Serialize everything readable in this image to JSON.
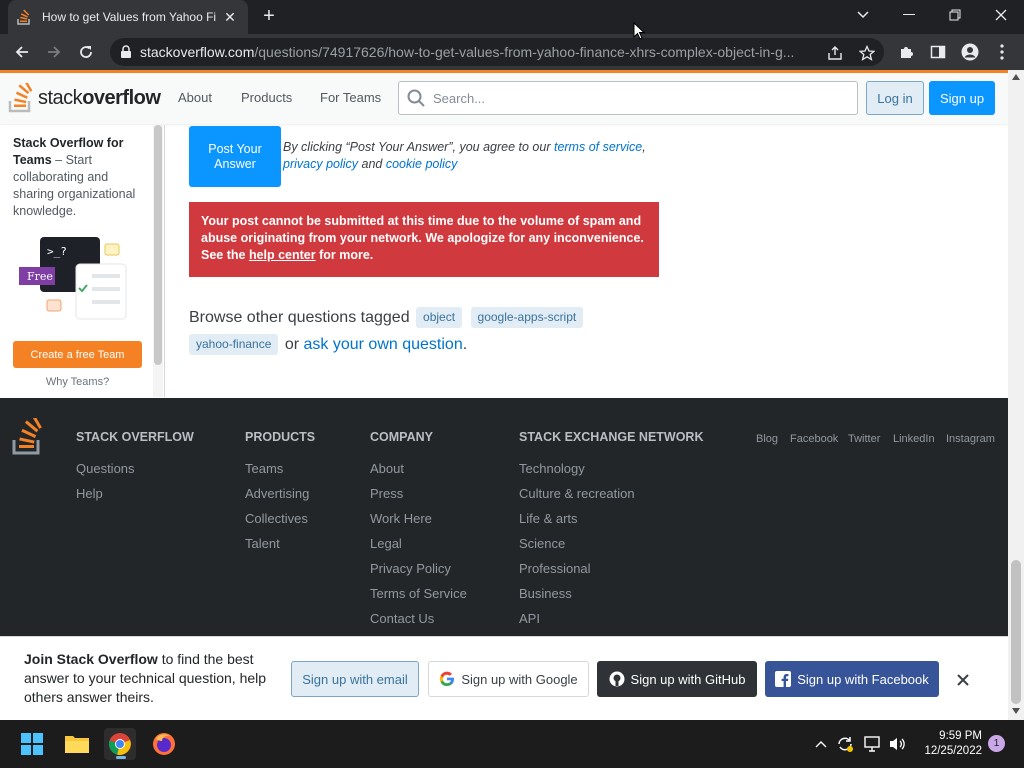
{
  "browser": {
    "tab_title": "How to get Values from Yahoo Fi",
    "url_host": "stackoverflow.com",
    "url_path": "/questions/74917626/how-to-get-values-from-yahoo-finance-xhrs-complex-object-in-g..."
  },
  "header": {
    "logo_prefix": "stack",
    "logo_suffix": "overflow",
    "nav": [
      "About",
      "Products",
      "For Teams"
    ],
    "search_placeholder": "Search...",
    "login_label": "Log in",
    "signup_label": "Sign up"
  },
  "sidebar": {
    "teams_title": "Stack Overflow for Teams",
    "teams_desc": " – Start collaborating and sharing organizational knowledge.",
    "free_badge": "Free",
    "prompt_glyph": ">_?",
    "create_team_label": "Create a free Team",
    "why_teams_label": "Why Teams?"
  },
  "answer": {
    "post_button_label": "Post Your Answer",
    "agree_prefix": "By clicking “Post Your Answer”, you agree to our ",
    "terms_link": "terms of service",
    "comma": ",",
    "privacy_link": "privacy policy",
    "and_text": " and ",
    "cookie_link": "cookie policy",
    "error_text_1": "Your post cannot be submitted at this time due to the volume of spam and abuse originating from your network. We apologize for any inconvenience. See the ",
    "error_link": "help center",
    "error_text_2": " for more.",
    "browse_prefix": "Browse other questions tagged ",
    "tags": [
      "object",
      "google-apps-script",
      "yahoo-finance"
    ],
    "or_text": " or ",
    "ask_link": "ask your own question",
    "period": "."
  },
  "footer": {
    "columns": [
      {
        "heading": "STACK OVERFLOW",
        "links": [
          "Questions",
          "Help"
        ]
      },
      {
        "heading": "PRODUCTS",
        "links": [
          "Teams",
          "Advertising",
          "Collectives",
          "Talent"
        ]
      },
      {
        "heading": "COMPANY",
        "links": [
          "About",
          "Press",
          "Work Here",
          "Legal",
          "Privacy Policy",
          "Terms of Service",
          "Contact Us"
        ]
      },
      {
        "heading": "STACK EXCHANGE NETWORK",
        "links": [
          "Technology",
          "Culture & recreation",
          "Life & arts",
          "Science",
          "Professional",
          "Business",
          "API"
        ]
      }
    ],
    "social": [
      "Blog",
      "Facebook",
      "Twitter",
      "LinkedIn",
      "Instagram"
    ]
  },
  "banner": {
    "join_bold": "Join Stack Overflow",
    "join_rest": " to find the best answer to your technical question, help others answer theirs.",
    "email_label": "Sign up with email",
    "google_label": "Sign up with Google",
    "github_label": "Sign up with GitHub",
    "facebook_label": "Sign up with Facebook"
  },
  "taskbar": {
    "time": "9:59 PM",
    "date": "12/25/2022",
    "notification_count": "1"
  },
  "colors": {
    "accent_orange": "#f48225",
    "primary_blue": "#0a95ff",
    "error_red": "#d0393e",
    "footer_bg": "#232629"
  }
}
